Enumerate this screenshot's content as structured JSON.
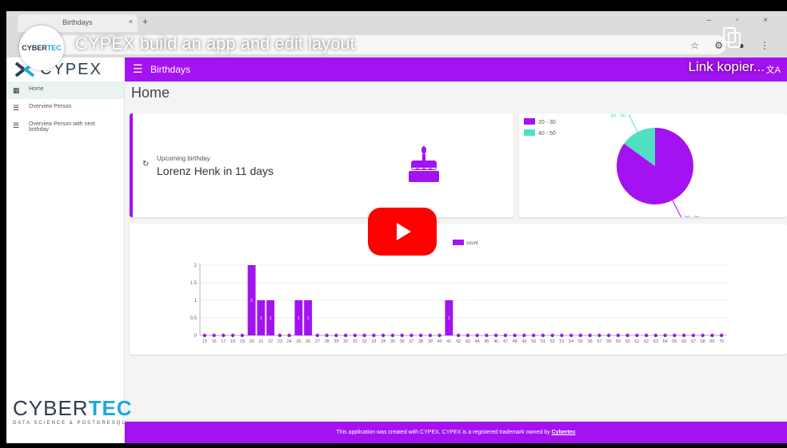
{
  "video": {
    "title": "CYPEX build an app and edit layout",
    "copy_link": "Link kopier...",
    "channel_avatar": {
      "main": "CYBER",
      "accent": "TEC"
    }
  },
  "browser": {
    "tab_title": "Birthdays",
    "tab_close": "×",
    "new_tab": "+",
    "window_controls": "–  ▫  ×",
    "toolbar_icons": "☆ ⚙ ● ⋮"
  },
  "app": {
    "logo_text": "CYPEX",
    "header_title": "Birthdays",
    "header_right": "文A",
    "page_title": "Home",
    "sidebar": {
      "items": [
        {
          "label": "Home",
          "icon": "dashboard-icon"
        },
        {
          "label": "Overview Person",
          "icon": "list-icon"
        },
        {
          "label": "Overview Person with next birthday",
          "icon": "list-icon"
        }
      ],
      "company_logo": {
        "main": "CYBER",
        "accent": "TEC",
        "tagline": "DATA SCIENCE & POSTGRESQL"
      }
    },
    "birthday_card": {
      "label": "Upcoming birthday",
      "value": "Lorenz Henk in 11 days",
      "refresh_icon": "↻"
    },
    "footer": {
      "text": "This application was created with CYPEX. CYPEX is a registered trademark owned by ",
      "link": "Cybertec"
    }
  },
  "colors": {
    "accent": "#a312f0",
    "pie_second": "#4fe0c3",
    "logo_blue": "#1aa9e0"
  },
  "chart_data": [
    {
      "type": "pie",
      "categories": [
        "20 - 30",
        "40 - 50"
      ],
      "values": [
        85,
        15
      ],
      "legend": "top-left",
      "colors": [
        "#a312f0",
        "#4fe0c3"
      ]
    },
    {
      "type": "bar",
      "categories": [
        "15",
        "16",
        "17",
        "18",
        "19",
        "20",
        "21",
        "22",
        "23",
        "24",
        "25",
        "26",
        "27",
        "28",
        "29",
        "30",
        "31",
        "32",
        "33",
        "34",
        "35",
        "36",
        "37",
        "38",
        "39",
        "40",
        "41",
        "42",
        "43",
        "44",
        "45",
        "46",
        "47",
        "48",
        "49",
        "50",
        "51",
        "52",
        "53",
        "54",
        "55",
        "56",
        "57",
        "58",
        "59",
        "60",
        "61",
        "62",
        "63",
        "64",
        "65",
        "66",
        "67",
        "68",
        "69",
        "70"
      ],
      "series": [
        {
          "name": "count",
          "values": [
            0,
            0,
            0,
            0,
            0,
            2,
            1,
            1,
            0,
            0,
            1,
            1,
            0,
            0,
            0,
            0,
            0,
            0,
            0,
            0,
            0,
            0,
            0,
            0,
            0,
            0,
            1,
            0,
            0,
            0,
            0,
            0,
            0,
            0,
            0,
            0,
            0,
            0,
            0,
            0,
            0,
            0,
            0,
            0,
            0,
            0,
            0,
            0,
            0,
            0,
            0,
            0,
            0,
            0,
            0,
            0
          ]
        }
      ],
      "yticks": [
        "0",
        "0.5",
        "1",
        "1.5",
        "2"
      ],
      "ylim": [
        0,
        2
      ],
      "grid": true,
      "legend": "top"
    }
  ]
}
